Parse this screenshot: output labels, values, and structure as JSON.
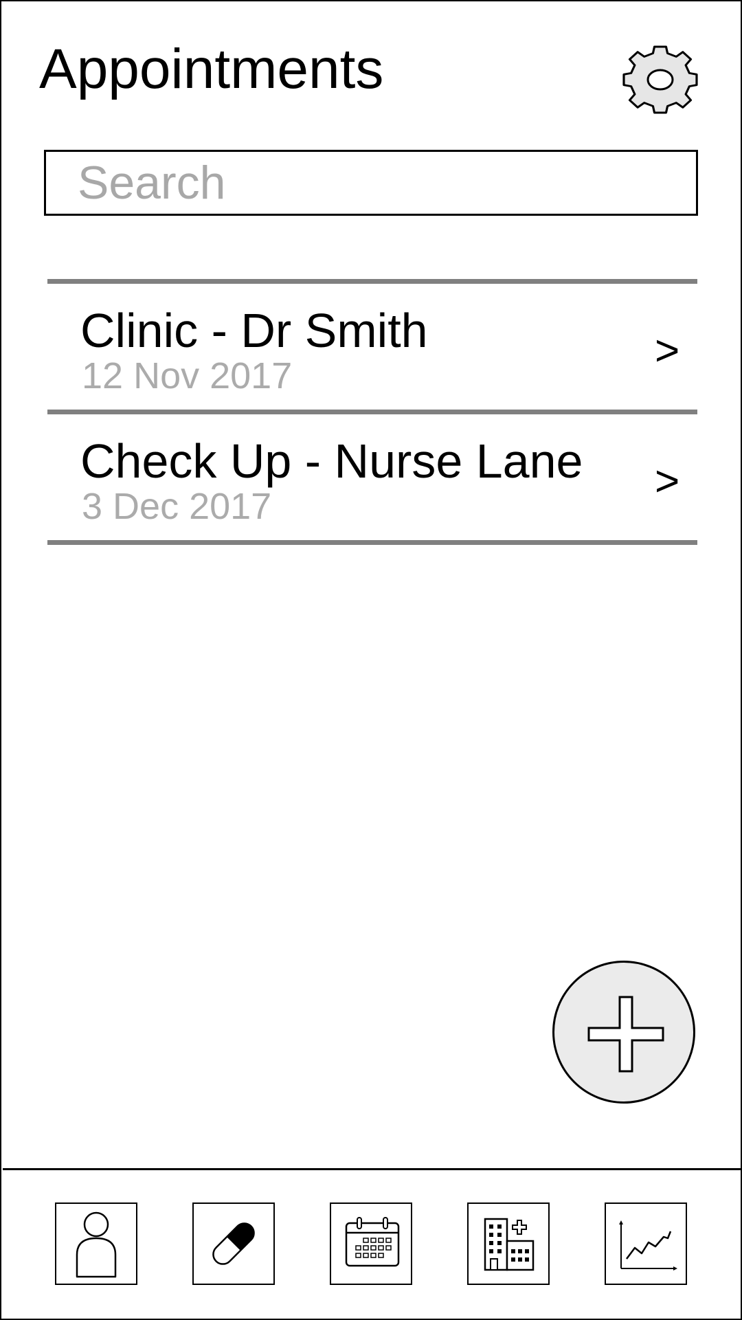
{
  "header": {
    "title": "Appointments",
    "settings_icon": "gear-icon"
  },
  "search": {
    "placeholder": "Search",
    "value": ""
  },
  "appointments": [
    {
      "name": "Clinic - Dr Smith",
      "date": "12 Nov 2017",
      "chevron": ">"
    },
    {
      "name": "Check Up - Nurse Lane",
      "date": "3 Dec 2017",
      "chevron": ">"
    }
  ],
  "fab": {
    "icon": "plus-icon"
  },
  "bottom_nav": [
    {
      "icon": "person-icon"
    },
    {
      "icon": "pill-icon"
    },
    {
      "icon": "calendar-icon"
    },
    {
      "icon": "hospital-icon"
    },
    {
      "icon": "chart-icon"
    }
  ],
  "colors": {
    "divider": "#808080",
    "placeholder": "#a8a8a8",
    "date_text": "#ababab",
    "fab_fill": "#ebebeb",
    "gear_fill": "#e6e6e6"
  }
}
